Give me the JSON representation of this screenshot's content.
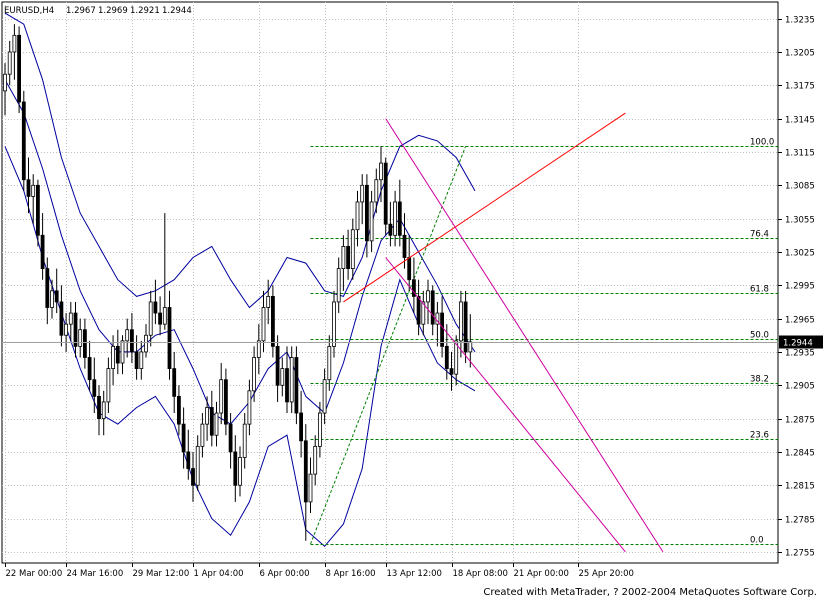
{
  "chart_data": {
    "type": "candlestick",
    "header": {
      "symbol": "EURUSD,H4",
      "open": "1.2967",
      "high": "1.2969",
      "low": "1.2921",
      "close": "1.2944"
    },
    "current_price": 1.2944,
    "current_price_label": "1.2944",
    "y_range": [
      1.2745,
      1.325
    ],
    "y_ticks": [
      "1.3235",
      "1.3205",
      "1.3175",
      "1.3145",
      "1.3115",
      "1.3085",
      "1.3055",
      "1.3025",
      "1.2995",
      "1.2965",
      "1.2935",
      "1.2905",
      "1.2875",
      "1.2845",
      "1.2815",
      "1.2785",
      "1.2755"
    ],
    "x_ticks": [
      "22 Mar 00:00",
      "24 Mar 16:00",
      "29 Mar 12:00",
      "1 Apr 04:00",
      "6 Apr 00:00",
      "8 Apr 16:00",
      "13 Apr 12:00",
      "18 Apr 08:00",
      "21 Apr 00:00",
      "25 Apr 20:00"
    ],
    "bar_count": 100,
    "candles": [
      [
        1.317,
        1.3195,
        1.3148,
        1.3185
      ],
      [
        1.3185,
        1.3215,
        1.3175,
        1.3205
      ],
      [
        1.3205,
        1.323,
        1.318,
        1.322
      ],
      [
        1.322,
        1.3228,
        1.315,
        1.316
      ],
      [
        1.316,
        1.317,
        1.308,
        1.309
      ],
      [
        1.309,
        1.311,
        1.306,
        1.3075
      ],
      [
        1.3075,
        1.3095,
        1.305,
        1.3085
      ],
      [
        1.3085,
        1.309,
        1.303,
        1.304
      ],
      [
        1.304,
        1.306,
        1.3,
        1.301
      ],
      [
        1.301,
        1.302,
        1.296,
        1.2975
      ],
      [
        1.2975,
        1.3,
        1.2965,
        1.299
      ],
      [
        1.299,
        1.301,
        1.297,
        1.298
      ],
      [
        1.298,
        1.2995,
        1.294,
        1.295
      ],
      [
        1.295,
        1.297,
        1.2935,
        1.296
      ],
      [
        1.296,
        1.298,
        1.2945,
        1.297
      ],
      [
        1.297,
        1.298,
        1.293,
        1.294
      ],
      [
        1.294,
        1.2965,
        1.293,
        1.2955
      ],
      [
        1.2955,
        1.2965,
        1.292,
        1.293
      ],
      [
        1.293,
        1.2945,
        1.29,
        1.291
      ],
      [
        1.291,
        1.293,
        1.288,
        1.2895
      ],
      [
        1.2895,
        1.2905,
        1.286,
        1.2875
      ],
      [
        1.2875,
        1.29,
        1.286,
        1.289
      ],
      [
        1.289,
        1.293,
        1.288,
        1.292
      ],
      [
        1.292,
        1.295,
        1.2905,
        1.294
      ],
      [
        1.294,
        1.2955,
        1.2915,
        1.2925
      ],
      [
        1.2925,
        1.295,
        1.2915,
        1.2945
      ],
      [
        1.2945,
        1.2965,
        1.293,
        1.2955
      ],
      [
        1.2955,
        1.297,
        1.2925,
        1.2935
      ],
      [
        1.2935,
        1.295,
        1.291,
        1.292
      ],
      [
        1.292,
        1.2945,
        1.291,
        1.2935
      ],
      [
        1.2935,
        1.296,
        1.293,
        1.295
      ],
      [
        1.295,
        1.299,
        1.294,
        1.298
      ],
      [
        1.298,
        1.3,
        1.296,
        1.297
      ],
      [
        1.297,
        1.2985,
        1.295,
        1.296
      ],
      [
        1.296,
        1.306,
        1.2955,
        1.2975
      ],
      [
        1.2975,
        1.299,
        1.291,
        1.292
      ],
      [
        1.292,
        1.2935,
        1.288,
        1.2895
      ],
      [
        1.2895,
        1.2905,
        1.286,
        1.287
      ],
      [
        1.287,
        1.2885,
        1.283,
        1.2845
      ],
      [
        1.2845,
        1.2865,
        1.282,
        1.283
      ],
      [
        1.283,
        1.2845,
        1.28,
        1.2815
      ],
      [
        1.2815,
        1.286,
        1.281,
        1.285
      ],
      [
        1.285,
        1.288,
        1.284,
        1.287
      ],
      [
        1.287,
        1.2895,
        1.2855,
        1.2885
      ],
      [
        1.2885,
        1.29,
        1.285,
        1.286
      ],
      [
        1.286,
        1.289,
        1.285,
        1.288
      ],
      [
        1.288,
        1.2925,
        1.287,
        1.291
      ],
      [
        1.291,
        1.292,
        1.286,
        1.287
      ],
      [
        1.287,
        1.288,
        1.283,
        1.2845
      ],
      [
        1.2845,
        1.286,
        1.28,
        1.2815
      ],
      [
        1.2815,
        1.285,
        1.2805,
        1.284
      ],
      [
        1.284,
        1.288,
        1.283,
        1.287
      ],
      [
        1.287,
        1.291,
        1.286,
        1.29
      ],
      [
        1.29,
        1.294,
        1.289,
        1.293
      ],
      [
        1.293,
        1.296,
        1.2915,
        1.2945
      ],
      [
        1.2945,
        1.299,
        1.2935,
        1.2975
      ],
      [
        1.2975,
        1.3,
        1.296,
        1.2985
      ],
      [
        1.2985,
        1.2995,
        1.293,
        1.294
      ],
      [
        1.294,
        1.295,
        1.289,
        1.2905
      ],
      [
        1.2905,
        1.293,
        1.2895,
        1.292
      ],
      [
        1.292,
        1.294,
        1.288,
        1.289
      ],
      [
        1.289,
        1.294,
        1.288,
        1.293
      ],
      [
        1.293,
        1.294,
        1.287,
        1.288
      ],
      [
        1.288,
        1.29,
        1.284,
        1.2855
      ],
      [
        1.2855,
        1.287,
        1.2765,
        1.28
      ],
      [
        1.28,
        1.284,
        1.279,
        1.2825
      ],
      [
        1.2825,
        1.286,
        1.2815,
        1.285
      ],
      [
        1.285,
        1.289,
        1.284,
        1.288
      ],
      [
        1.288,
        1.292,
        1.287,
        1.291
      ],
      [
        1.291,
        1.295,
        1.29,
        1.294
      ],
      [
        1.294,
        1.299,
        1.293,
        1.298
      ],
      [
        1.298,
        1.302,
        1.297,
        1.301
      ],
      [
        1.301,
        1.304,
        1.299,
        1.303
      ],
      [
        1.303,
        1.3045,
        1.3,
        1.301
      ],
      [
        1.301,
        1.3055,
        1.3,
        1.3045
      ],
      [
        1.3045,
        1.308,
        1.303,
        1.307
      ],
      [
        1.307,
        1.3095,
        1.305,
        1.3085
      ],
      [
        1.3085,
        1.3095,
        1.302,
        1.3035
      ],
      [
        1.3035,
        1.308,
        1.3025,
        1.307
      ],
      [
        1.307,
        1.31,
        1.306,
        1.309
      ],
      [
        1.309,
        1.312,
        1.307,
        1.3105
      ],
      [
        1.3105,
        1.311,
        1.304,
        1.305
      ],
      [
        1.305,
        1.307,
        1.303,
        1.304
      ],
      [
        1.304,
        1.308,
        1.303,
        1.307
      ],
      [
        1.307,
        1.309,
        1.303,
        1.304
      ],
      [
        1.304,
        1.306,
        1.301,
        1.302
      ],
      [
        1.302,
        1.304,
        1.299,
        1.3
      ],
      [
        1.3,
        1.302,
        1.297,
        1.2985
      ],
      [
        1.2985,
        1.3,
        1.295,
        1.296
      ],
      [
        1.296,
        1.299,
        1.295,
        1.298
      ],
      [
        1.298,
        1.3,
        1.296,
        1.299
      ],
      [
        1.299,
        1.2995,
        1.295,
        1.296
      ],
      [
        1.296,
        1.298,
        1.294,
        1.297
      ],
      [
        1.297,
        1.2985,
        1.293,
        1.294
      ],
      [
        1.294,
        1.296,
        1.291,
        1.292
      ],
      [
        1.292,
        1.2935,
        1.29,
        1.2915
      ],
      [
        1.2915,
        1.295,
        1.2905,
        1.2945
      ],
      [
        1.2945,
        1.299,
        1.293,
        1.298
      ],
      [
        1.298,
        1.299,
        1.2925,
        1.2935
      ],
      [
        1.2935,
        1.2969,
        1.2921,
        1.2944
      ]
    ],
    "bollinger_upper": [
      [
        0,
        1.324
      ],
      [
        4,
        1.323
      ],
      [
        8,
        1.318
      ],
      [
        12,
        1.311
      ],
      [
        16,
        1.306
      ],
      [
        20,
        1.303
      ],
      [
        24,
        1.3
      ],
      [
        28,
        1.2985
      ],
      [
        32,
        1.299
      ],
      [
        36,
        1.3
      ],
      [
        40,
        1.302
      ],
      [
        44,
        1.303
      ],
      [
        48,
        1.3
      ],
      [
        52,
        1.2975
      ],
      [
        56,
        1.299
      ],
      [
        60,
        1.302
      ],
      [
        64,
        1.3015
      ],
      [
        68,
        1.299
      ],
      [
        72,
        1.2985
      ],
      [
        76,
        1.302
      ],
      [
        80,
        1.308
      ],
      [
        84,
        1.312
      ],
      [
        88,
        1.313
      ],
      [
        92,
        1.3125
      ],
      [
        96,
        1.311
      ],
      [
        100,
        1.308
      ]
    ],
    "bollinger_middle": [
      [
        0,
        1.318
      ],
      [
        4,
        1.315
      ],
      [
        8,
        1.31
      ],
      [
        12,
        1.304
      ],
      [
        16,
        1.299
      ],
      [
        20,
        1.2955
      ],
      [
        24,
        1.2935
      ],
      [
        28,
        1.2935
      ],
      [
        32,
        1.295
      ],
      [
        36,
        1.2955
      ],
      [
        40,
        1.292
      ],
      [
        44,
        1.288
      ],
      [
        48,
        1.287
      ],
      [
        52,
        1.289
      ],
      [
        56,
        1.292
      ],
      [
        60,
        1.2935
      ],
      [
        64,
        1.2895
      ],
      [
        68,
        1.288
      ],
      [
        72,
        1.2925
      ],
      [
        76,
        1.2985
      ],
      [
        80,
        1.3035
      ],
      [
        84,
        1.3055
      ],
      [
        88,
        1.3025
      ],
      [
        92,
        1.2995
      ],
      [
        96,
        1.296
      ],
      [
        100,
        1.2935
      ]
    ],
    "bollinger_lower": [
      [
        0,
        1.312
      ],
      [
        4,
        1.308
      ],
      [
        8,
        1.302
      ],
      [
        12,
        1.297
      ],
      [
        16,
        1.292
      ],
      [
        20,
        1.288
      ],
      [
        24,
        1.287
      ],
      [
        28,
        1.2885
      ],
      [
        32,
        1.2895
      ],
      [
        36,
        1.287
      ],
      [
        40,
        1.282
      ],
      [
        44,
        1.2785
      ],
      [
        48,
        1.277
      ],
      [
        52,
        1.28
      ],
      [
        56,
        1.285
      ],
      [
        60,
        1.286
      ],
      [
        64,
        1.2775
      ],
      [
        68,
        1.276
      ],
      [
        72,
        1.278
      ],
      [
        76,
        1.283
      ],
      [
        80,
        1.294
      ],
      [
        84,
        1.3
      ],
      [
        88,
        1.296
      ],
      [
        92,
        1.2925
      ],
      [
        96,
        1.291
      ],
      [
        100,
        1.29
      ]
    ],
    "fibonacci": {
      "levels": [
        {
          "label": "100.0",
          "price": 1.312
        },
        {
          "label": "76.4",
          "price": 1.3038
        },
        {
          "label": "61.8",
          "price": 1.2988
        },
        {
          "label": "50.0",
          "price": 1.2947
        },
        {
          "label": "38.2",
          "price": 1.2907
        },
        {
          "label": "23.6",
          "price": 1.2857
        },
        {
          "label": "0.0",
          "price": 1.2762
        }
      ],
      "start_bar": 65,
      "anchor_low": [
        65,
        1.2762
      ],
      "anchor_high": [
        98,
        1.312
      ]
    },
    "trend_lines": [
      {
        "color": "#ff0000",
        "from": [
          72,
          1.298
        ],
        "to": [
          132,
          1.315
        ]
      },
      {
        "color": "#d000a0",
        "from": [
          81,
          1.3145
        ],
        "to": [
          140,
          1.2755
        ]
      },
      {
        "color": "#d000a0",
        "from": [
          81,
          1.302
        ],
        "to": [
          132,
          1.2755
        ]
      }
    ],
    "footer": "Created with MetaTrader, ? 2002-2004 MetaQuotes Software Corp."
  }
}
